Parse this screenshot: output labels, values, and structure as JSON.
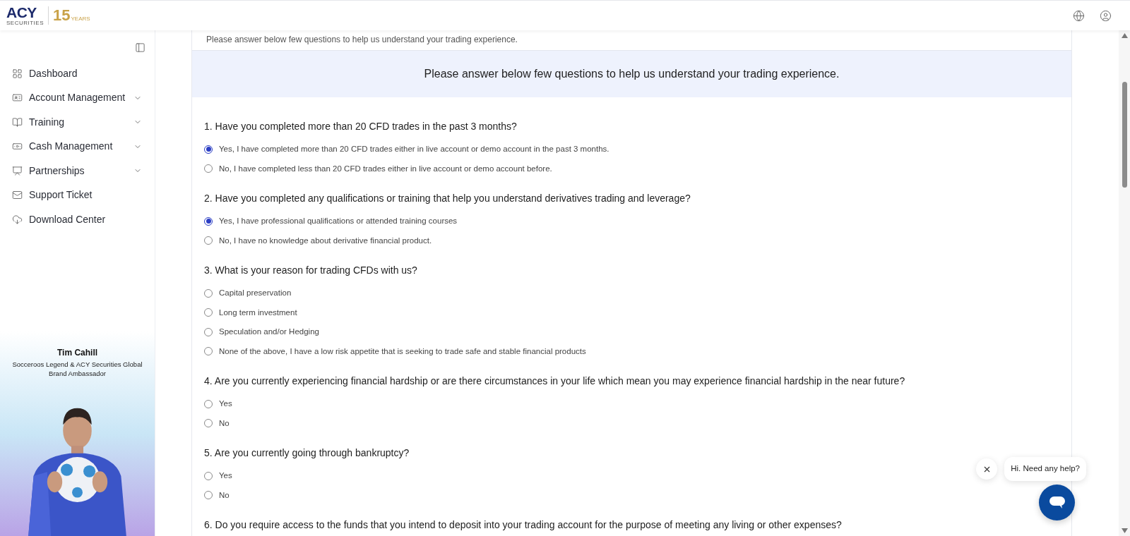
{
  "header": {
    "logo": {
      "brand": "ACY",
      "tagline": "SECURITIES",
      "anniversary": "15",
      "anniversary_caption": "YEARS"
    }
  },
  "sidebar": {
    "items": [
      {
        "label": "Dashboard",
        "expandable": false
      },
      {
        "label": "Account Management",
        "expandable": true
      },
      {
        "label": "Training",
        "expandable": true
      },
      {
        "label": "Cash Management",
        "expandable": true
      },
      {
        "label": "Partnerships",
        "expandable": true
      },
      {
        "label": "Support Ticket",
        "expandable": false
      },
      {
        "label": "Download Center",
        "expandable": false
      }
    ]
  },
  "ambassador": {
    "name": "Tim Cahill",
    "title": "Socceroos Legend & ACY Securities Global Brand Ambassador"
  },
  "form": {
    "intro": "Please answer below few questions to help us understand your trading experience.",
    "banner": "Please answer below few questions to help us understand your trading experience.",
    "questions": [
      {
        "text": "1. Have you completed more than 20 CFD trades in the past 3 months?",
        "options": [
          {
            "label": "Yes, I have completed more than 20 CFD trades either in live account or demo account in the past 3 months.",
            "selected": true
          },
          {
            "label": "No, I have completed less than 20 CFD trades either in live account or demo account before.",
            "selected": false
          }
        ]
      },
      {
        "text": "2. Have you completed any qualifications or training that help you understand derivatives trading and leverage?",
        "options": [
          {
            "label": "Yes, I have professional qualifications or attended training courses",
            "selected": true
          },
          {
            "label": "No, I have no knowledge about derivative financial product.",
            "selected": false
          }
        ]
      },
      {
        "text": "3. What is your reason for trading CFDs with us?",
        "options": [
          {
            "label": "Capital preservation",
            "selected": false
          },
          {
            "label": "Long term investment",
            "selected": false
          },
          {
            "label": "Speculation and/or Hedging",
            "selected": false
          },
          {
            "label": "None of the above, I have a low risk appetite that is seeking to trade safe and stable financial products",
            "selected": false
          }
        ]
      },
      {
        "text": "4. Are you currently experiencing financial hardship or are there circumstances in your life which mean you may experience financial hardship in the near future?",
        "options": [
          {
            "label": "Yes",
            "selected": false
          },
          {
            "label": "No",
            "selected": false
          }
        ]
      },
      {
        "text": "5. Are you currently going through bankruptcy?",
        "options": [
          {
            "label": "Yes",
            "selected": false
          },
          {
            "label": "No",
            "selected": false
          }
        ]
      },
      {
        "text": "6. Do you require access to the funds that you intend to deposit into your trading account for the purpose of meeting any living or other expenses?"
      }
    ]
  },
  "chat": {
    "greeting": "Hi. Need any help?"
  }
}
